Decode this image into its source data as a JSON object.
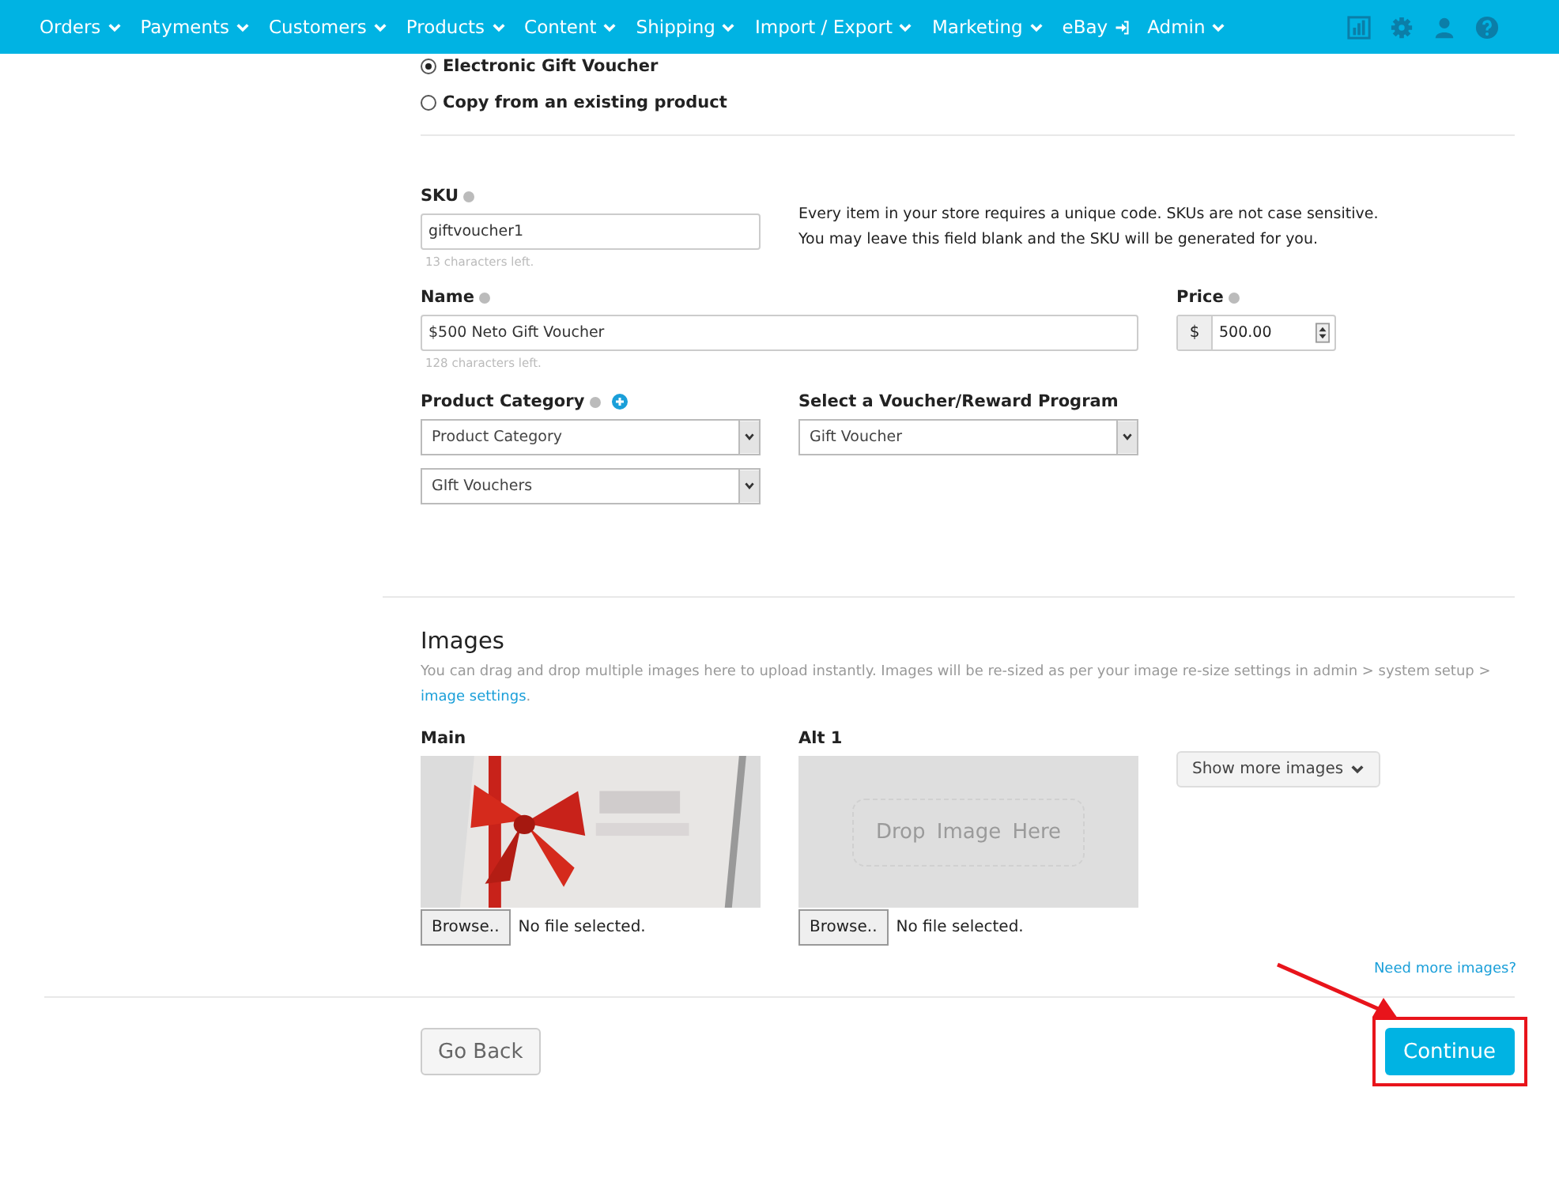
{
  "nav": {
    "items": [
      {
        "label": "Orders",
        "kind": "menu"
      },
      {
        "label": "Payments",
        "kind": "menu"
      },
      {
        "label": "Customers",
        "kind": "menu"
      },
      {
        "label": "Products",
        "kind": "menu"
      },
      {
        "label": "Content",
        "kind": "menu"
      },
      {
        "label": "Shipping",
        "kind": "menu"
      },
      {
        "label": "Import / Export",
        "kind": "menu"
      },
      {
        "label": "Marketing",
        "kind": "menu"
      },
      {
        "label": "eBay",
        "kind": "external"
      },
      {
        "label": "Admin",
        "kind": "menu"
      }
    ]
  },
  "product_type": [
    {
      "label": "Electronic Gift Voucher",
      "selected": true
    },
    {
      "label": "Copy from an existing product",
      "selected": false
    }
  ],
  "sku": {
    "label": "SKU",
    "value": "giftvoucher1",
    "counter": "13 characters left.",
    "help": [
      "Every item in your store requires a unique code. SKUs are not case sensitive.",
      "You may leave this field blank and the SKU will be generated for you."
    ]
  },
  "name": {
    "label": "Name",
    "value": "$500 Neto Gift Voucher",
    "counter": "128 characters left."
  },
  "price": {
    "label": "Price",
    "prefix": "$",
    "value": "500.00"
  },
  "category": {
    "label": "Product Category",
    "selects": [
      "Product Category",
      "GIft Vouchers"
    ]
  },
  "voucher_program": {
    "label": "Select a Voucher/Reward Program",
    "value": "Gift Voucher"
  },
  "images": {
    "title": "Images",
    "description": "You can drag and drop multiple images here to upload instantly. Images will be re-sized as per your image re-size settings in admin > system setup > ",
    "link": "image settings",
    "after_link": ".",
    "slots": [
      {
        "label": "Main",
        "kind": "picture",
        "browse": "Browse..",
        "status": "No file selected."
      },
      {
        "label": "Alt 1",
        "kind": "drop",
        "drop_text": "Drop Image Here",
        "browse": "Browse..",
        "status": "No file selected."
      }
    ],
    "show_more": "Show more images",
    "need_more": "Need more images?"
  },
  "buttons": {
    "back": "Go Back",
    "continue": "Continue"
  }
}
